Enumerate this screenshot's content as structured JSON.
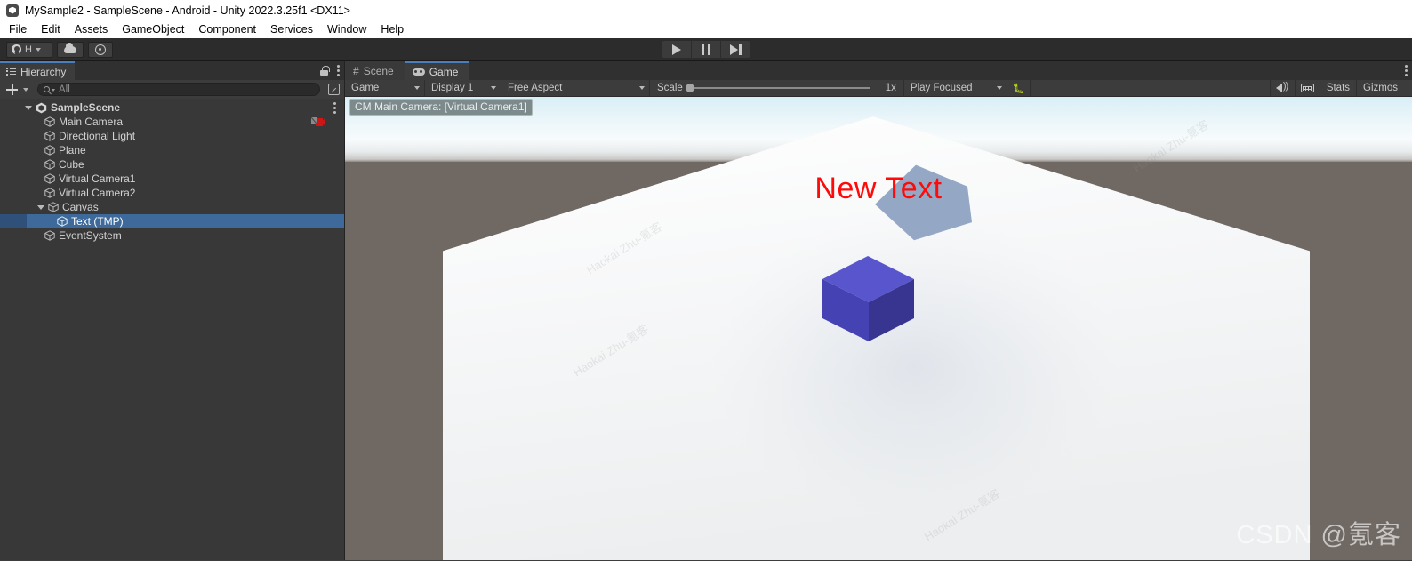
{
  "window": {
    "title": "MySample2 - SampleScene - Android - Unity 2022.3.25f1 <DX11>",
    "logo_icon": "unity-logo-icon"
  },
  "menubar": {
    "items": [
      {
        "label": "File"
      },
      {
        "label": "Edit"
      },
      {
        "label": "Assets"
      },
      {
        "label": "GameObject"
      },
      {
        "label": "Component"
      },
      {
        "label": "Services"
      },
      {
        "label": "Window"
      },
      {
        "label": "Help"
      }
    ]
  },
  "toolbar": {
    "account_label": "H",
    "account_icon": "person-icon",
    "cloud_icon": "cloud-icon",
    "settings_icon": "gear-icon",
    "play_icon": "play-icon",
    "pause_icon": "pause-icon",
    "step_icon": "step-icon"
  },
  "hierarchy": {
    "tab_label": "Hierarchy",
    "tab_icon": "hierarchy-icon",
    "lock_icon": "lock-icon",
    "menu_icon": "kebab-menu-icon",
    "add_icon": "plus-icon",
    "search": {
      "value": "",
      "placeholder": "All",
      "icon": "search-icon"
    },
    "popout_icon": "popout-icon",
    "scene": {
      "label": "SampleScene",
      "expanded": true,
      "menu_icon": "kebab-menu-icon"
    },
    "items": [
      {
        "label": "Main Camera",
        "depth": 1,
        "expandable": false,
        "selected": false,
        "badge": "camera-preview-icon"
      },
      {
        "label": "Directional Light",
        "depth": 1,
        "expandable": false,
        "selected": false
      },
      {
        "label": "Plane",
        "depth": 1,
        "expandable": false,
        "selected": false
      },
      {
        "label": "Cube",
        "depth": 1,
        "expandable": false,
        "selected": false
      },
      {
        "label": "Virtual Camera1",
        "depth": 1,
        "expandable": false,
        "selected": false
      },
      {
        "label": "Virtual Camera2",
        "depth": 1,
        "expandable": false,
        "selected": false
      },
      {
        "label": "Canvas",
        "depth": 1,
        "expandable": true,
        "selected": false
      },
      {
        "label": "Text (TMP)",
        "depth": 2,
        "expandable": false,
        "selected": true
      },
      {
        "label": "EventSystem",
        "depth": 1,
        "expandable": false,
        "selected": false
      }
    ]
  },
  "viewtabs": {
    "scene": {
      "label": "Scene",
      "icon": "grid-hash-icon",
      "active": false
    },
    "game": {
      "label": "Game",
      "icon": "gamepad-icon",
      "active": true
    },
    "menu_icon": "kebab-menu-icon"
  },
  "gametoolbar": {
    "target_display_mode": "Game",
    "display": "Display 1",
    "aspect": "Free Aspect",
    "scale_label": "Scale",
    "scale_value": "1x",
    "scale_percent": 0,
    "play_mode": "Play Focused",
    "debug_icon": "bug-icon",
    "mute_icon": "speaker-icon",
    "keyboard_icon": "keyboard-icon",
    "stats_label": "Stats",
    "gizmos_label": "Gizmos",
    "gizmos_caret_icon": "chevron-down-icon"
  },
  "gameview": {
    "cinemachine_label": "CM Main Camera: [Virtual Camera1]",
    "ui_text": "New Text",
    "ui_text_color": "#fd0b0b",
    "cube_color": "#4240ac",
    "plane_color": "#f7f8f8",
    "ground_color": "#6f6863",
    "watermarks": [
      "Haokai Zhu-氪客",
      "Haokai Zhu-氪客",
      "Haokai Zhu-氪客",
      "Haokai Zhu-氪客"
    ],
    "csdn_watermark": "CSDN @氪客"
  }
}
